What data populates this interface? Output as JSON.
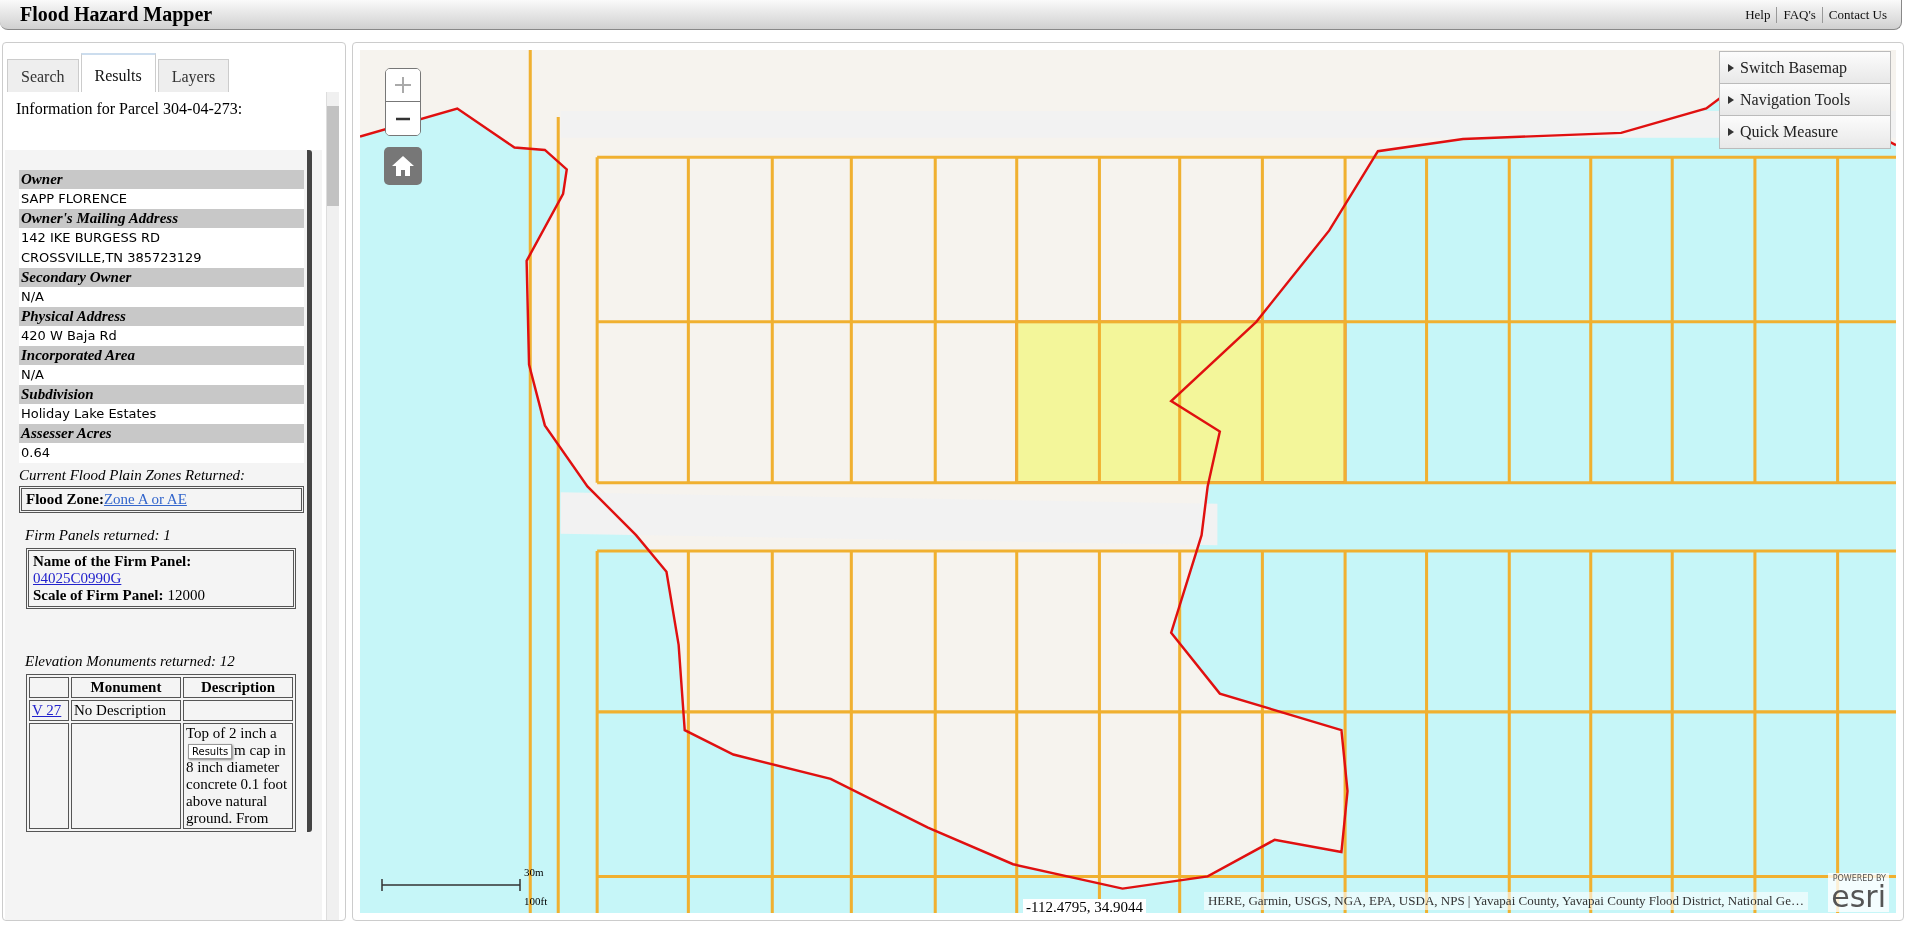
{
  "app": {
    "title": "Flood Hazard Mapper",
    "links": [
      "Help",
      "FAQ's",
      "Contact Us"
    ]
  },
  "tabs": [
    {
      "label": "Search",
      "selected": false
    },
    {
      "label": "Results",
      "selected": true
    },
    {
      "label": "Layers",
      "selected": false
    }
  ],
  "results": {
    "heading": "Information for Parcel 304-04-273:",
    "fields": [
      {
        "label": "Owner",
        "values": [
          "SAPP FLORENCE"
        ]
      },
      {
        "label": "Owner's Mailing Address",
        "values": [
          "142 IKE BURGESS RD",
          "CROSSVILLE,TN  385723129"
        ]
      },
      {
        "label": "Secondary Owner",
        "values": [
          "N/A"
        ]
      },
      {
        "label": "Physical Address",
        "values": [
          "420 W Baja Rd"
        ]
      },
      {
        "label": "Incorporated Area",
        "values": [
          "N/A"
        ]
      },
      {
        "label": "Subdivision",
        "values": [
          "Holiday Lake Estates"
        ]
      },
      {
        "label": "Assesser Acres",
        "values": [
          "0.64"
        ]
      }
    ],
    "flood_zones": {
      "caption": "Current Flood Plain Zones Returned:",
      "label": "Flood Zone:",
      "link": "Zone A or AE"
    },
    "firm_panels": {
      "caption": "Firm Panels returned: 1",
      "name_label": "Name of the Firm Panel:",
      "name_link": "04025C0990G",
      "scale_label": "Scale of Firm Panel:",
      "scale": "12000"
    },
    "monuments": {
      "caption": "Elevation Monuments returned: 12",
      "columns": [
        "Monument",
        "Description"
      ],
      "rows": [
        {
          "link": "V 27",
          "monument": "No Description"
        },
        {
          "description_before": "Top of 2 inch a",
          "description_after": "m cap in 8 inch diameter concrete 0.1 foot above natural ground. From"
        }
      ]
    },
    "tooltip": "Results"
  },
  "map": {
    "tools": [
      "Switch Basemap",
      "Navigation Tools",
      "Quick Measure"
    ],
    "scale": {
      "metric": "30m",
      "imperial": "100ft"
    },
    "coordinates": "-112.4795, 34.9044",
    "attribution": "HERE, Garmin, USGS, NGA, EPA, USDA, NPS | Yavapai County, Yavapai County Flood District, National Ge…",
    "logo": {
      "caption": "POWERED BY",
      "name": "esri"
    }
  }
}
